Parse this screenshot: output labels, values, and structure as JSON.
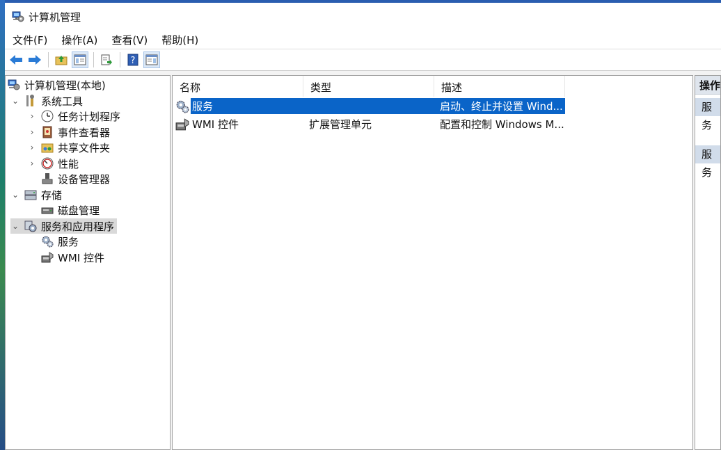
{
  "window": {
    "title": "计算机管理"
  },
  "menu": [
    "文件(F)",
    "操作(A)",
    "查看(V)",
    "帮助(H)"
  ],
  "toolbar": {
    "buttons": [
      "back-icon",
      "forward-icon",
      "up-folder-icon",
      "show-hide-tree-icon",
      "export-list-icon",
      "help-icon",
      "show-hide-action-icon"
    ]
  },
  "tree": {
    "root": "计算机管理(本地)",
    "system_tools": "系统工具",
    "task_scheduler": "任务计划程序",
    "event_viewer": "事件查看器",
    "shared_folders": "共享文件夹",
    "performance": "性能",
    "device_manager": "设备管理器",
    "storage": "存储",
    "disk_management": "磁盘管理",
    "services_apps": "服务和应用程序",
    "services": "服务",
    "wmi": "WMI 控件"
  },
  "list": {
    "columns": [
      "名称",
      "类型",
      "描述"
    ],
    "rows": [
      {
        "name": "服务",
        "type": "",
        "desc": "启动、终止并设置 Wind..."
      },
      {
        "name": "WMI 控件",
        "type": "扩展管理单元",
        "desc": "配置和控制 Windows M..."
      }
    ]
  },
  "actions": {
    "header": "操作",
    "items": [
      "服务",
      "服务"
    ]
  }
}
